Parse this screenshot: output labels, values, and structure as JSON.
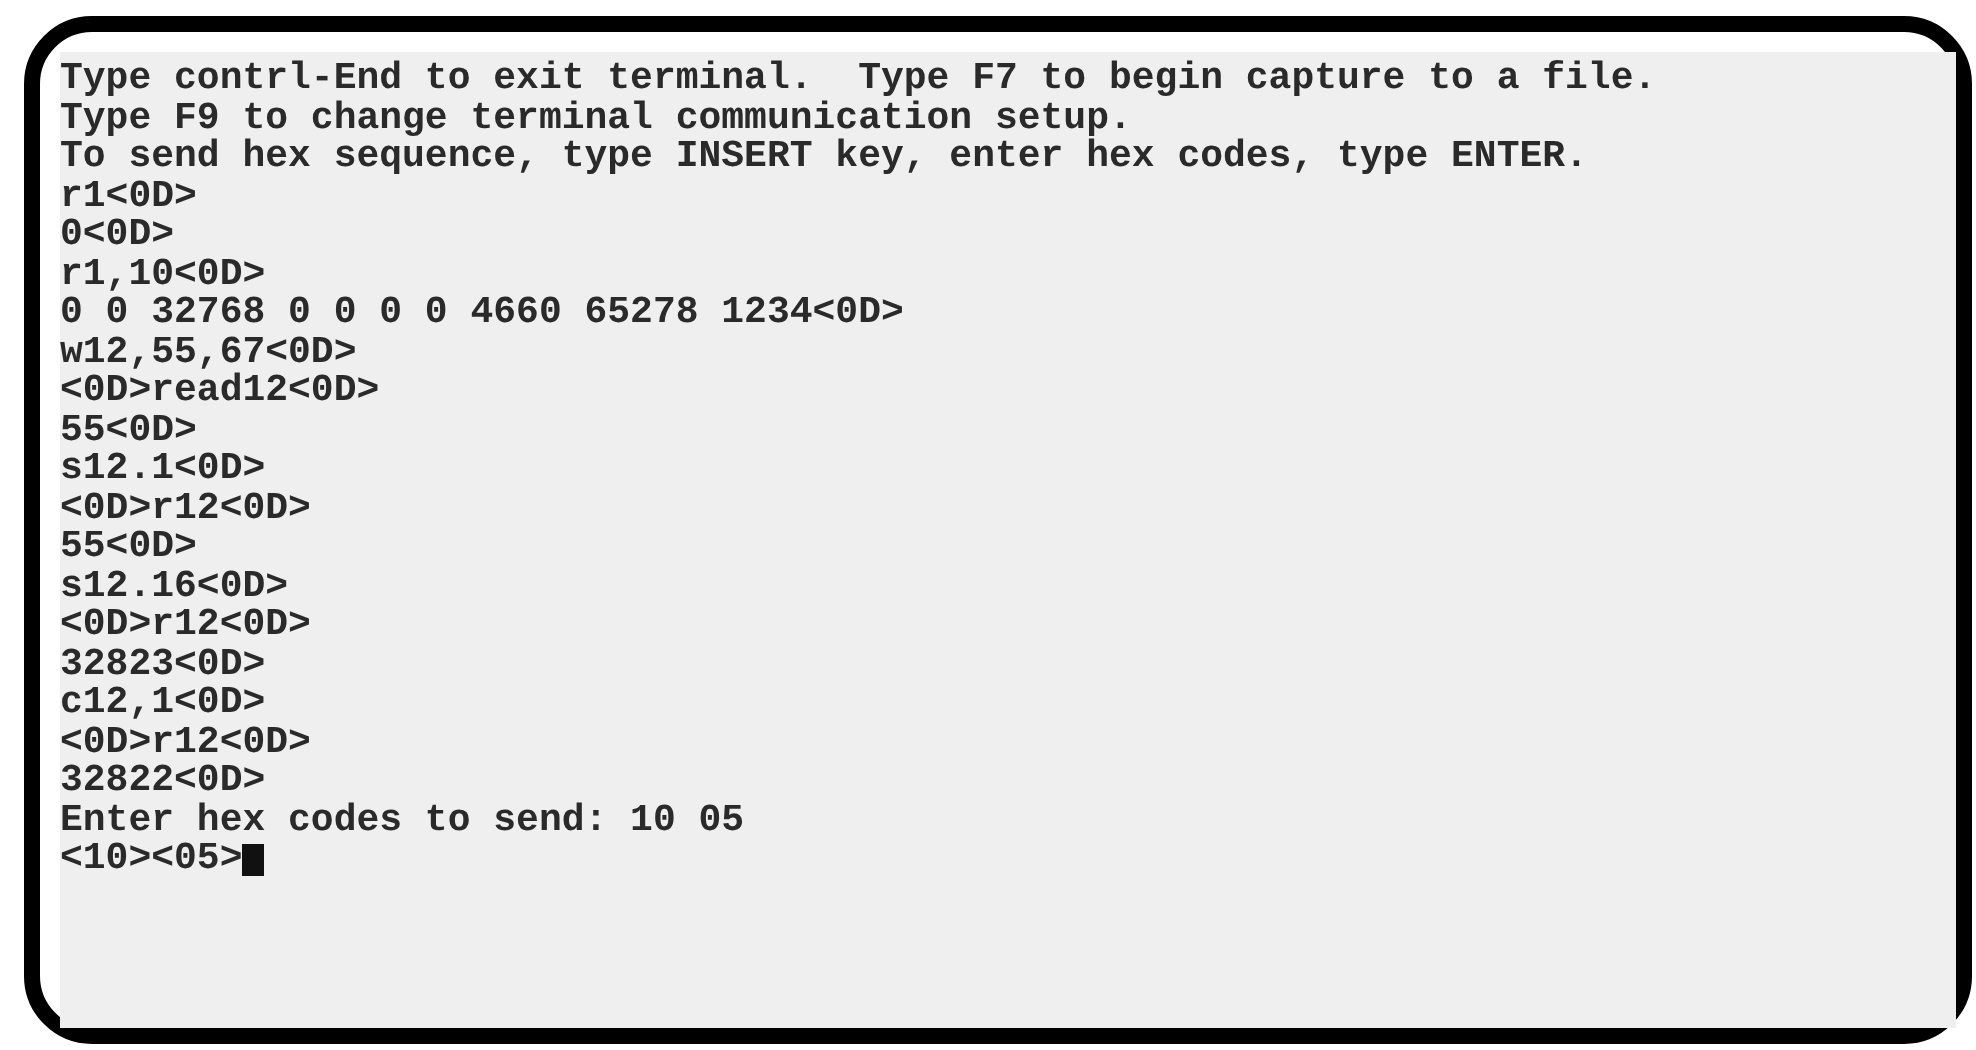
{
  "terminal": {
    "lines": [
      "Type contrl-End to exit terminal.  Type F7 to begin capture to a file.",
      "Type F9 to change terminal communication setup.",
      "To send hex sequence, type INSERT key, enter hex codes, type ENTER.",
      "r1<0D>",
      "0<0D>",
      "r1,10<0D>",
      "0 0 32768 0 0 0 0 4660 65278 1234<0D>",
      "w12,55,67<0D>",
      "<0D>read12<0D>",
      "55<0D>",
      "s12.1<0D>",
      "<0D>r12<0D>",
      "55<0D>",
      "s12.16<0D>",
      "<0D>r12<0D>",
      "32823<0D>",
      "c12,1<0D>",
      "<0D>r12<0D>",
      "32822<0D>",
      "Enter hex codes to send: 10 05",
      "<10><05>"
    ],
    "cursor_visible": true
  }
}
